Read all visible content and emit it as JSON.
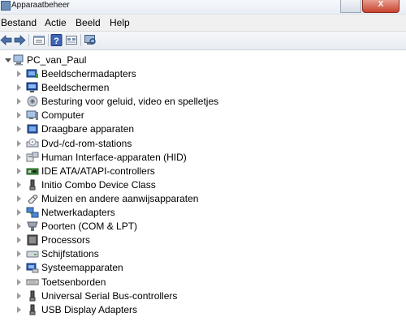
{
  "window": {
    "title": "Apparaatbeheer",
    "close_symbol": "X"
  },
  "menu": [
    "Bestand",
    "Actie",
    "Beeld",
    "Help"
  ],
  "toolbar": {
    "buttons": [
      "back-arrow-icon",
      "forward-arrow-icon",
      "properties-icon",
      "help-icon",
      "show-hidden-icon",
      "scan-hardware-icon"
    ]
  },
  "tree": {
    "root": "PC_van_Paul",
    "items": [
      {
        "label": "Beeldschermadapters",
        "icon": "display-adapter-icon"
      },
      {
        "label": "Beeldschermen",
        "icon": "monitor-icon"
      },
      {
        "label": "Besturing voor geluid, video en spelletjes",
        "icon": "speaker-icon"
      },
      {
        "label": "Computer",
        "icon": "computer-icon"
      },
      {
        "label": "Draagbare apparaten",
        "icon": "portable-device-icon"
      },
      {
        "label": "Dvd-/cd-rom-stations",
        "icon": "dvd-drive-icon"
      },
      {
        "label": "Human Interface-apparaten (HID)",
        "icon": "hid-icon"
      },
      {
        "label": "IDE ATA/ATAPI-controllers",
        "icon": "ide-controller-icon"
      },
      {
        "label": "Initio Combo Device Class",
        "icon": "usb-device-icon"
      },
      {
        "label": "Muizen en andere aanwijsapparaten",
        "icon": "mouse-icon"
      },
      {
        "label": "Netwerkadapters",
        "icon": "network-adapter-icon"
      },
      {
        "label": "Poorten (COM & LPT)",
        "icon": "port-icon"
      },
      {
        "label": "Processors",
        "icon": "processor-icon"
      },
      {
        "label": "Schijfstations",
        "icon": "disk-drive-icon"
      },
      {
        "label": "Systeemapparaten",
        "icon": "system-device-icon"
      },
      {
        "label": "Toetsenborden",
        "icon": "keyboard-icon"
      },
      {
        "label": "Universal Serial Bus-controllers",
        "icon": "usb-controller-icon"
      },
      {
        "label": "USB Display Adapters",
        "icon": "usb-display-icon"
      }
    ]
  }
}
